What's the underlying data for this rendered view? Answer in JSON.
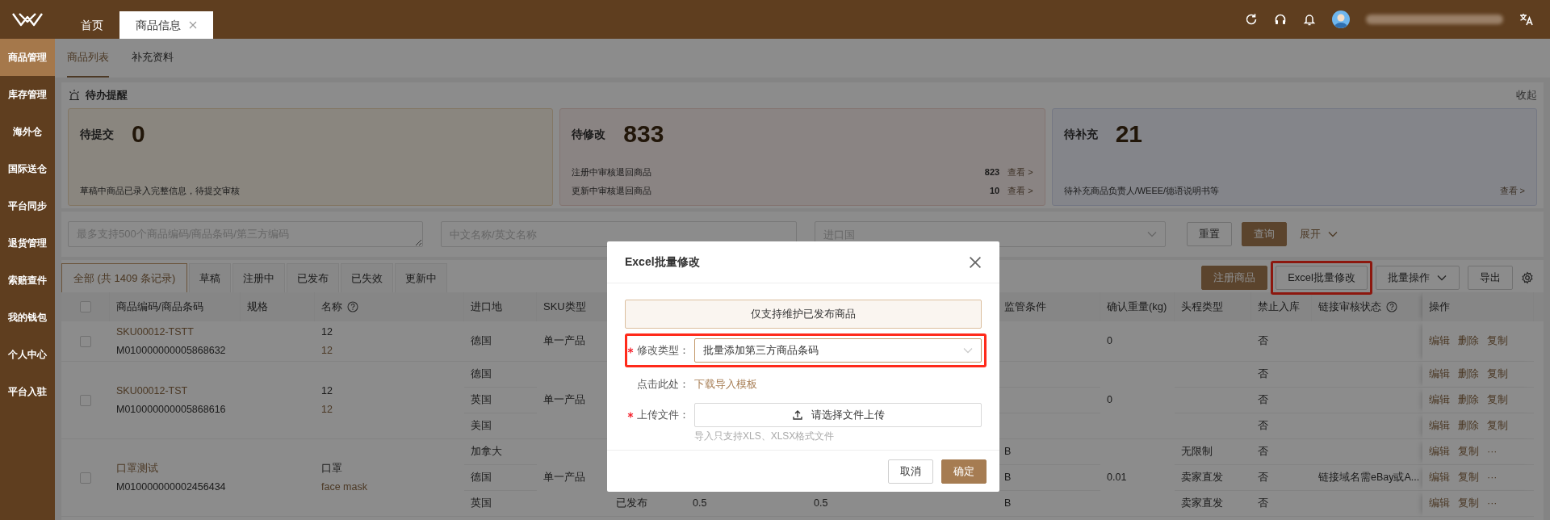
{
  "header": {
    "tabs": [
      {
        "label": "首页",
        "selected": false,
        "closable": false
      },
      {
        "label": "商品信息",
        "selected": true,
        "closable": true
      }
    ]
  },
  "sidebar": {
    "items": [
      {
        "label": "商品管理",
        "selected": true
      },
      {
        "label": "库存管理",
        "selected": false
      },
      {
        "label": "海外仓",
        "selected": false
      },
      {
        "label": "国际送仓",
        "selected": false
      },
      {
        "label": "平台同步",
        "selected": false
      },
      {
        "label": "退货管理",
        "selected": false
      },
      {
        "label": "索赔查件",
        "selected": false
      },
      {
        "label": "我的钱包",
        "selected": false
      },
      {
        "label": "个人中心",
        "selected": false
      },
      {
        "label": "平台入驻",
        "selected": false
      }
    ]
  },
  "subtabs": [
    {
      "label": "商品列表",
      "selected": true
    },
    {
      "label": "补充资料",
      "selected": false
    }
  ],
  "reminders": {
    "title": "待办提醒",
    "collapse": "收起",
    "cards": [
      {
        "kind": "draft",
        "label": "待提交",
        "count": "0",
        "lines": [
          {
            "text": "草稿中商品已录入完整信息，待提交审核"
          }
        ]
      },
      {
        "kind": "returned",
        "label": "待修改",
        "count": "833",
        "lines": [
          {
            "text": "注册中审核退回商品",
            "count": "823",
            "link": "查看 >"
          },
          {
            "text": "更新中审核退回商品",
            "count": "10",
            "link": "查看 >"
          }
        ]
      },
      {
        "kind": "supplement",
        "label": "待补充",
        "count": "21",
        "lines": [
          {
            "text": "待补充商品负责人/WEEE/德语说明书等",
            "link": "查看 >"
          }
        ]
      }
    ]
  },
  "filters": {
    "codes_placeholder": "最多支持500个商品编码/商品条码/第三方编码",
    "name_placeholder": "中文名称/英文名称",
    "country_placeholder": "进口国",
    "reset": "重置",
    "search": "查询",
    "expand": "展开"
  },
  "status_tabs": [
    {
      "label": "全部 (共 1409 条记录)",
      "selected": true
    },
    {
      "label": "草稿",
      "selected": false
    },
    {
      "label": "注册中",
      "selected": false
    },
    {
      "label": "已发布",
      "selected": false
    },
    {
      "label": "已失效",
      "selected": false
    },
    {
      "label": "更新中",
      "selected": false
    }
  ],
  "actions": [
    {
      "label": "注册商品",
      "kind": "primary",
      "highlighted": false
    },
    {
      "label": "Excel批量修改",
      "kind": "default",
      "highlighted": true
    },
    {
      "label": "批量操作",
      "kind": "dropdown",
      "highlighted": false
    },
    {
      "label": "导出",
      "kind": "default",
      "highlighted": false
    }
  ],
  "table": {
    "all_checked": false,
    "columns": [
      {
        "label": "商品编码/商品条码",
        "help": false
      },
      {
        "label": "规格",
        "help": false
      },
      {
        "label": "名称",
        "help": true
      },
      {
        "label": "进口地",
        "help": false
      },
      {
        "label": "SKU类型",
        "help": false
      },
      {
        "label": "监管条件",
        "help": false
      },
      {
        "label": "确认重量(kg)",
        "help": false
      },
      {
        "label": "头程类型",
        "help": false
      },
      {
        "label": "禁止入库",
        "help": false
      },
      {
        "label": "链接审核状态",
        "help": true
      },
      {
        "label": "操作",
        "help": false
      }
    ],
    "rows": [
      {
        "checked": false,
        "code": "SKU00012-TSTT",
        "barcode": "M010000000005868632",
        "name_cn": "12",
        "name_en": "12",
        "sku_type": "单一产品",
        "weight": "0",
        "subrows": [
          {
            "country": "德国",
            "ban": "否",
            "actions": [
              "编辑",
              "删除",
              "复制"
            ]
          }
        ]
      },
      {
        "checked": false,
        "code": "SKU00012-TST",
        "barcode": "M010000000005868616",
        "name_cn": "12",
        "name_en": "12",
        "sku_type": "单一产品",
        "weight": "0",
        "subrows": [
          {
            "country": "德国",
            "ban": "否",
            "actions": [
              "编辑",
              "删除",
              "复制"
            ]
          },
          {
            "country": "英国",
            "ban": "否",
            "actions": [
              "编辑",
              "删除",
              "复制"
            ]
          },
          {
            "country": "美国",
            "ban": "否",
            "actions": [
              "编辑",
              "删除",
              "复制"
            ]
          }
        ]
      },
      {
        "checked": false,
        "code": "口罩测试",
        "barcode": "M010000000002456434",
        "name_cn": "口罩",
        "name_en": "face mask",
        "sku_type": "单一产品",
        "weight": "0.01",
        "subrows": [
          {
            "country": "加拿大",
            "regulation": "B",
            "trunk_type": "无限制",
            "ban": "否",
            "actions": [
              "编辑",
              "复制"
            ],
            "more": "···"
          },
          {
            "country": "德国",
            "regulation": "B",
            "trunk_type": "卖家直发",
            "ban": "否",
            "link_status": "链接域名需eBay或A...",
            "actions": [
              "编辑",
              "复制"
            ],
            "more": "···"
          },
          {
            "country": "英国",
            "column_7": "已发布",
            "column_8": "0.5",
            "column_9": "0.5",
            "regulation": "B",
            "trunk_type": "卖家直发",
            "ban": "否",
            "actions": [
              "编辑",
              "复制"
            ],
            "more": "···"
          }
        ]
      }
    ]
  },
  "dialog": {
    "title": "Excel批量修改",
    "notice": "仅支持维护已发布商品",
    "fields": [
      {
        "kind": "select",
        "label": "修改类型：",
        "required": true,
        "value": "批量添加第三方商品条码",
        "highlighted": true
      },
      {
        "kind": "link",
        "label": "点击此处：",
        "required": false,
        "link": "下载导入模板",
        "highlighted": false
      },
      {
        "kind": "upload",
        "label": "上传文件：",
        "required": true,
        "button": "请选择文件上传",
        "hint": "导入只支持XLS、XLSX格式文件",
        "highlighted": false
      }
    ],
    "buttons": [
      {
        "label": "取消",
        "kind": "default"
      },
      {
        "label": "确定",
        "kind": "primary"
      }
    ]
  }
}
